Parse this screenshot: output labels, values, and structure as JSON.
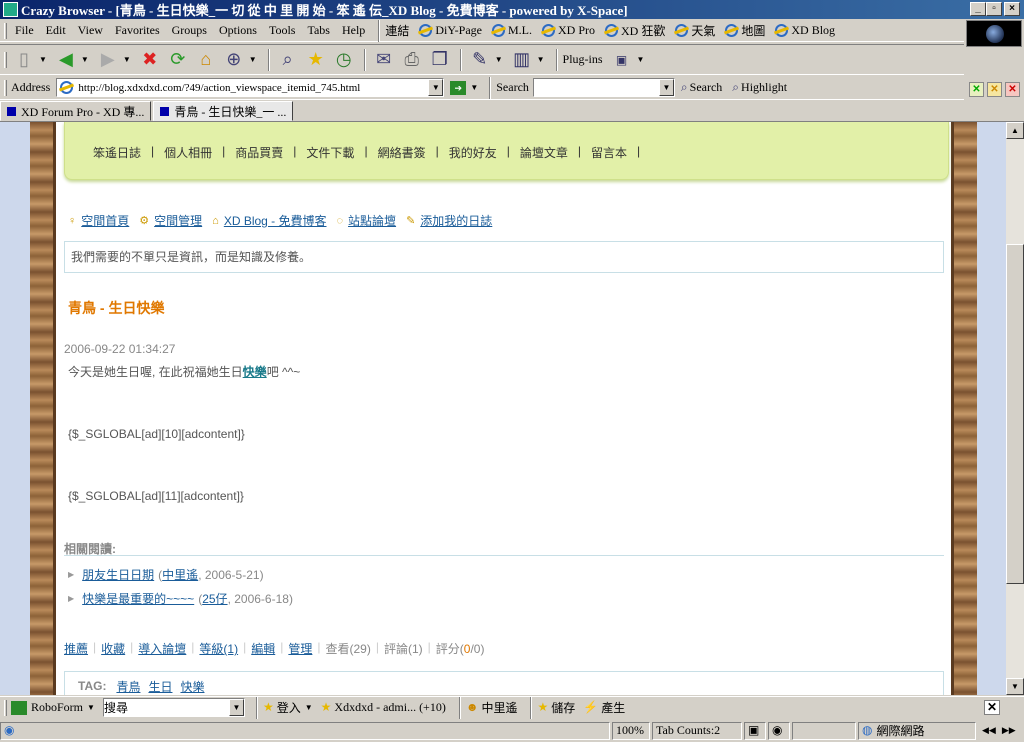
{
  "window": {
    "title": "Crazy Browser - [青鳥 - 生日快樂_一 切 從 中 里 開 始 - 笨 遙 伝_XD Blog - 免費博客 - powered by X-Space]"
  },
  "menu": [
    "File",
    "Edit",
    "View",
    "Favorites",
    "Groups",
    "Options",
    "Tools",
    "Tabs",
    "Help"
  ],
  "links": [
    "連結",
    "DiY-Page",
    "M.L.",
    "XD Pro",
    "XD 狂歡",
    "天氣",
    "地圖",
    "XD Blog"
  ],
  "toolbar": {
    "plugins_label": "Plug-ins"
  },
  "address": {
    "label": "Address",
    "url": "http://blog.xdxdxd.com/?49/action_viewspace_itemid_745.html",
    "search_label": "Search",
    "search_value": "",
    "search_btn": "Search",
    "highlight_btn": "Highlight"
  },
  "tabs": [
    {
      "label": "XD Forum Pro - XD 專..."
    },
    {
      "label": "青鳥 - 生日快樂_一 ..."
    }
  ],
  "blog": {
    "nav": [
      "笨遙日誌",
      "個人相冊",
      "商品買賣",
      "文件下載",
      "網絡書簽",
      "我的好友",
      "論壇文章",
      "留言本"
    ],
    "quicklinks": [
      "空間首頁",
      "空間管理",
      "XD Blog - 免費博客",
      "站點論壇",
      "添加我的日誌"
    ],
    "motto": "我們需要的不單只是資訊，而是知識及修養。",
    "post": {
      "title": "青鳥 - 生日快樂",
      "date": "2006-09-22 01:34:27",
      "body_pre": "今天是她生日喔, 在此祝福她生日",
      "body_link": "快樂",
      "body_post": "吧 ^^~",
      "ad1": "{$_SGLOBAL[ad][10][adcontent]}",
      "ad2": "{$_SGLOBAL[ad][11][adcontent]}"
    },
    "related": {
      "heading": "相關閱讀:",
      "items": [
        {
          "title": "朋友生日日期",
          "author": "中里遙",
          "date": ", 2006-5-21)"
        },
        {
          "title": "快樂是最重要的~~~~",
          "author": "25仔",
          "date": ", 2006-6-18)"
        }
      ]
    },
    "actions": {
      "recommend": "推薦",
      "favorite": "收藏",
      "import": "導入論壇",
      "rating": "等級(1)",
      "edit": "編輯",
      "manage": "管理",
      "views": "查看(29)",
      "comments": "評論(1)",
      "score_label": "評分(",
      "score_a": "0",
      "score_sep": "/",
      "score_b": "0",
      "score_end": ")"
    },
    "tags": {
      "label": "TAG:",
      "items": [
        "青鳥",
        "生日",
        "快樂"
      ]
    }
  },
  "bottombar": {
    "roboform": "RoboForm",
    "search_value": "搜尋",
    "login": "登入",
    "account": "Xdxdxd - admi... (+10)",
    "identity": "中里遙",
    "save": "儲存",
    "generate": "產生"
  },
  "statusbar": {
    "zoom": "100%",
    "tab_count": "Tab Counts:2",
    "zone": "網際網路"
  }
}
